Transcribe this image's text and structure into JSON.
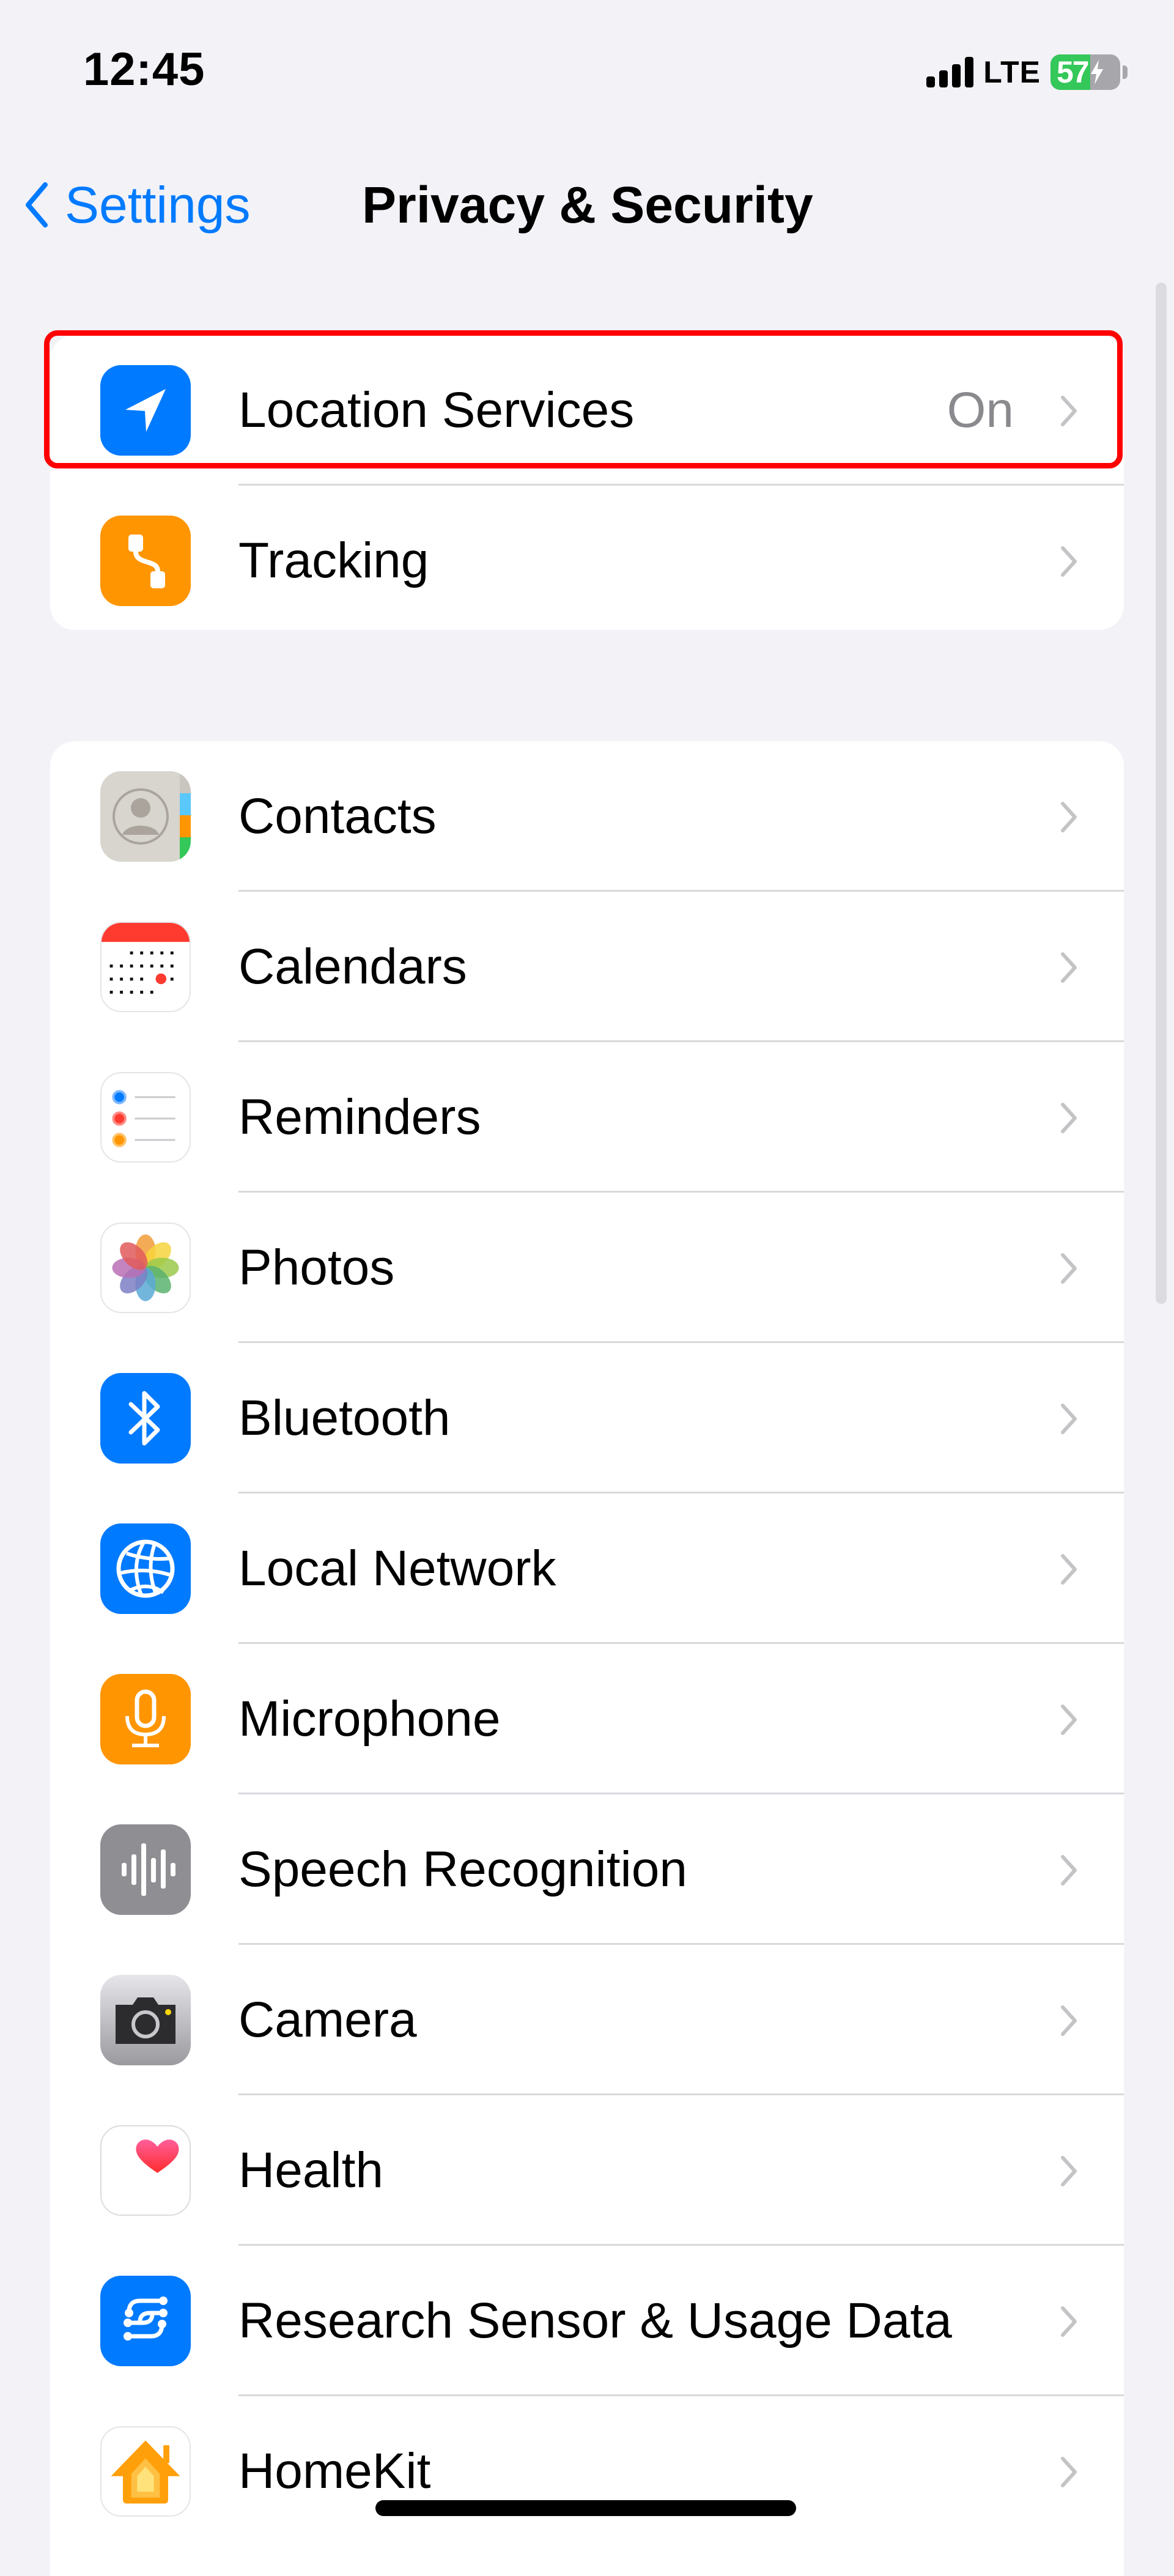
{
  "status_bar": {
    "time": "12:45",
    "network": "LTE",
    "battery_percent": "57",
    "battery_level": 0.57,
    "charging": true,
    "signal_bars": 4
  },
  "nav": {
    "back_label": "Settings",
    "title": "Privacy & Security"
  },
  "groups": [
    {
      "items": [
        {
          "label": "Location Services",
          "value": "On",
          "icon": "location-arrow-icon",
          "highlighted": true
        },
        {
          "label": "Tracking",
          "value": "",
          "icon": "tracking-icon"
        }
      ]
    },
    {
      "items": [
        {
          "label": "Contacts",
          "icon": "contacts-icon"
        },
        {
          "label": "Calendars",
          "icon": "calendar-icon"
        },
        {
          "label": "Reminders",
          "icon": "reminders-icon"
        },
        {
          "label": "Photos",
          "icon": "photos-icon"
        },
        {
          "label": "Bluetooth",
          "icon": "bluetooth-icon"
        },
        {
          "label": "Local Network",
          "icon": "globe-icon"
        },
        {
          "label": "Microphone",
          "icon": "microphone-icon"
        },
        {
          "label": "Speech Recognition",
          "icon": "waveform-icon"
        },
        {
          "label": "Camera",
          "icon": "camera-icon"
        },
        {
          "label": "Health",
          "icon": "heart-icon"
        },
        {
          "label": "Research Sensor & Usage Data",
          "icon": "research-icon"
        },
        {
          "label": "HomeKit",
          "icon": "home-icon"
        }
      ]
    }
  ],
  "colors": {
    "accent": "#007aff",
    "background": "#f2f2f7",
    "highlight": "#ff0000",
    "battery_green": "#34c759",
    "orange": "#ff9500",
    "gray_icon": "#8e8e93"
  }
}
